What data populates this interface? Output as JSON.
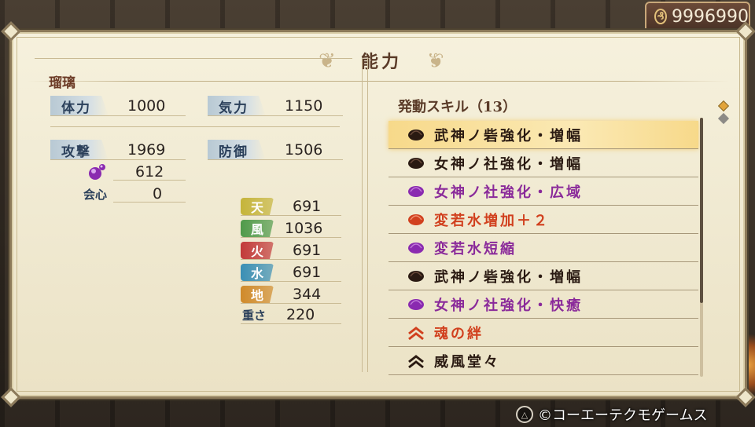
{
  "currency": {
    "icon": "coin-icon",
    "value": "9996990"
  },
  "header": {
    "title": "能力"
  },
  "character": {
    "name": "瑠璃"
  },
  "stats": {
    "hp": {
      "label": "体力",
      "value": "1000"
    },
    "ki": {
      "label": "気力",
      "value": "1150"
    },
    "attack": {
      "label": "攻撃",
      "value": "1969"
    },
    "defense": {
      "label": "防御",
      "value": "1506"
    },
    "magic": {
      "icon": "purple-orb-icon",
      "value": "612"
    },
    "critical": {
      "label": "会心",
      "value": "0"
    },
    "elements": [
      {
        "label": "天",
        "value": "691",
        "color": "#c5b43a"
      },
      {
        "label": "風",
        "value": "1036",
        "color": "#4f9a4a"
      },
      {
        "label": "火",
        "value": "691",
        "color": "#c23a3a"
      },
      {
        "label": "水",
        "value": "691",
        "color": "#3a8fb5"
      },
      {
        "label": "地",
        "value": "344",
        "color": "#d08a2a"
      }
    ],
    "weight": {
      "label": "重さ",
      "value": "220"
    }
  },
  "skills": {
    "title": "発動スキル（13）",
    "items": [
      {
        "label": "武神ノ砦強化・増幅",
        "color": "#2a1a12",
        "icon": "dark-orb-icon",
        "selected": true
      },
      {
        "label": "女神ノ社強化・増幅",
        "color": "#2a1a12",
        "icon": "dark-orb-icon"
      },
      {
        "label": "女神ノ社強化・広域",
        "color": "#8a2a9a",
        "icon": "purple-orb-icon"
      },
      {
        "label": "変若水増加＋２",
        "color": "#d1401e",
        "icon": "red-orb-icon"
      },
      {
        "label": "変若水短縮",
        "color": "#8a2a9a",
        "icon": "purple-orb-icon"
      },
      {
        "label": "武神ノ砦強化・増幅",
        "color": "#2a1a12",
        "icon": "dark-orb-icon"
      },
      {
        "label": "女神ノ社強化・快癒",
        "color": "#8a2a9a",
        "icon": "purple-orb-icon"
      },
      {
        "label": "魂の絆",
        "color": "#d1401e",
        "icon": "red-chevron-icon"
      },
      {
        "label": "威風堂々",
        "color": "#2a1a12",
        "icon": "dark-chevron-icon"
      }
    ]
  },
  "footer": {
    "button_icon": "triangle-button-icon",
    "copyright": "©コーエーテクモゲームス"
  }
}
